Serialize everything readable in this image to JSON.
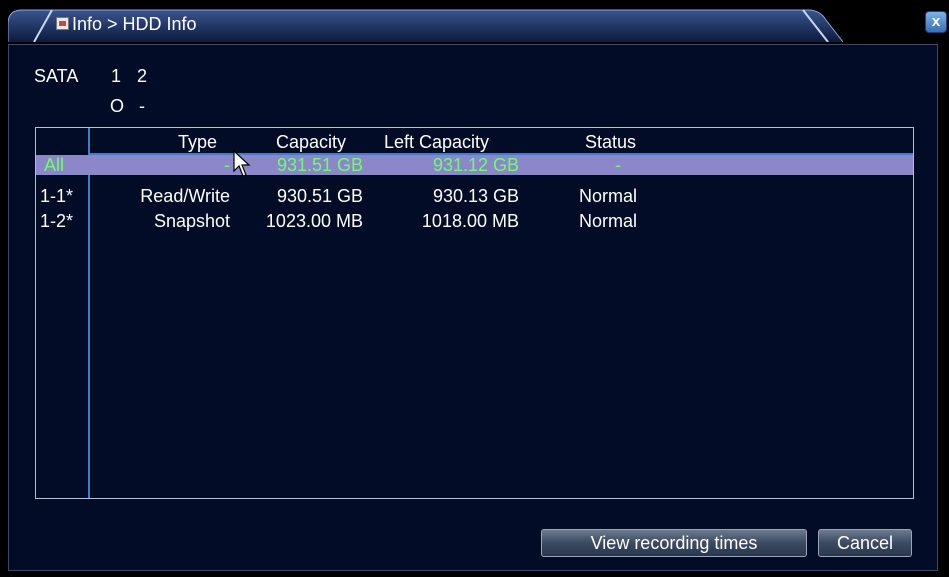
{
  "window": {
    "title": "Info > HDD Info",
    "close_symbol": "x",
    "colors": {
      "background": "#020c26",
      "accent": "#3d7fd0",
      "selected_row": "#8b87c9",
      "selected_text": "#6dff6d"
    }
  },
  "sata": {
    "label": "SATA",
    "disks": [
      {
        "number": "1",
        "state": "O"
      },
      {
        "number": "2",
        "state": "-"
      }
    ]
  },
  "table": {
    "headers": [
      "Type",
      "Capacity",
      "Left Capacity",
      "Status"
    ],
    "rows": [
      {
        "id": "All",
        "type": "-",
        "capacity": "931.51 GB",
        "left_capacity": "931.12 GB",
        "status": "-",
        "selected": true
      },
      {
        "id": "1-1*",
        "type": "Read/Write",
        "capacity": "930.51 GB",
        "left_capacity": "930.13 GB",
        "status": "Normal",
        "selected": false
      },
      {
        "id": "1-2*",
        "type": "Snapshot",
        "capacity": "1023.00 MB",
        "left_capacity": "1018.00 MB",
        "status": "Normal",
        "selected": false
      }
    ]
  },
  "buttons": {
    "view_recording_times": "View recording times",
    "cancel": "Cancel"
  },
  "icons": {
    "title_icon": "info-doc-icon",
    "close": "close-icon",
    "cursor": "mouse-pointer-icon"
  }
}
